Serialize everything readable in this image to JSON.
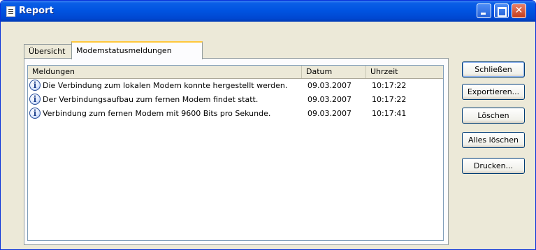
{
  "window": {
    "title": "Report",
    "icon": "report-document-icon"
  },
  "title_buttons": {
    "minimize": "minimize-icon",
    "maximize": "maximize-icon",
    "close": "close-icon",
    "close_glyph": "✕"
  },
  "tabs": [
    {
      "label": "Übersicht",
      "active": false
    },
    {
      "label": "Modemstatusmeldungen",
      "active": true
    }
  ],
  "list": {
    "columns": [
      "Meldungen",
      "Datum",
      "Uhrzeit"
    ],
    "rows": [
      {
        "icon": "info-icon",
        "message": "Die Verbindung zum lokalen Modem konnte hergestellt werden.",
        "date": "09.03.2007",
        "time": "10:17:22"
      },
      {
        "icon": "info-icon",
        "message": "Der Verbindungsaufbau zum fernen Modem findet statt.",
        "date": "09.03.2007",
        "time": "10:17:22"
      },
      {
        "icon": "info-icon",
        "message": "Verbindung zum fernen Modem mit 9600 Bits pro Sekunde.",
        "date": "09.03.2007",
        "time": "10:17:41"
      }
    ]
  },
  "buttons": {
    "close": "Schließen",
    "export": "Exportieren...",
    "delete": "Löschen",
    "delete_all": "Alles löschen",
    "print": "Drucken..."
  },
  "colors": {
    "titlebar": "#0053e0",
    "window_face": "#ece9d8",
    "tab_highlight": "#ffc83c"
  }
}
